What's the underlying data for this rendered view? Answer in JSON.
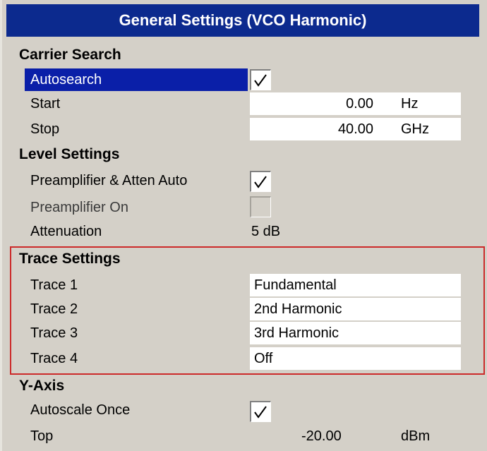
{
  "title": "General Settings (VCO Harmonic)",
  "carrier_search": {
    "heading": "Carrier Search",
    "autosearch_label": "Autosearch",
    "autosearch_checked": true,
    "start_label": "Start",
    "start_value": "0.00",
    "start_unit": "Hz",
    "stop_label": "Stop",
    "stop_value": "40.00",
    "stop_unit": "GHz"
  },
  "level_settings": {
    "heading": "Level Settings",
    "preamp_atten_auto_label": "Preamplifier & Atten Auto",
    "preamp_atten_auto_checked": true,
    "preamp_on_label": "Preamplifier On",
    "preamp_on_checked": false,
    "attenuation_label": "Attenuation",
    "attenuation_value": "5 dB"
  },
  "trace_settings": {
    "heading": "Trace Settings",
    "traces": [
      {
        "label": "Trace 1",
        "value": "Fundamental"
      },
      {
        "label": "Trace 2",
        "value": "2nd Harmonic"
      },
      {
        "label": "Trace 3",
        "value": "3rd Harmonic"
      },
      {
        "label": "Trace 4",
        "value": "Off"
      }
    ]
  },
  "y_axis": {
    "heading": "Y-Axis",
    "autoscale_once_label": "Autoscale Once",
    "autoscale_once_checked": true,
    "top_label": "Top",
    "top_value": "-20.00",
    "top_unit": "dBm"
  },
  "colors": {
    "title_bg": "#0c2a8e",
    "selection_bg": "#0a1fa8",
    "panel_bg": "#d4d0c8",
    "highlight_border": "#cc2a2a"
  }
}
